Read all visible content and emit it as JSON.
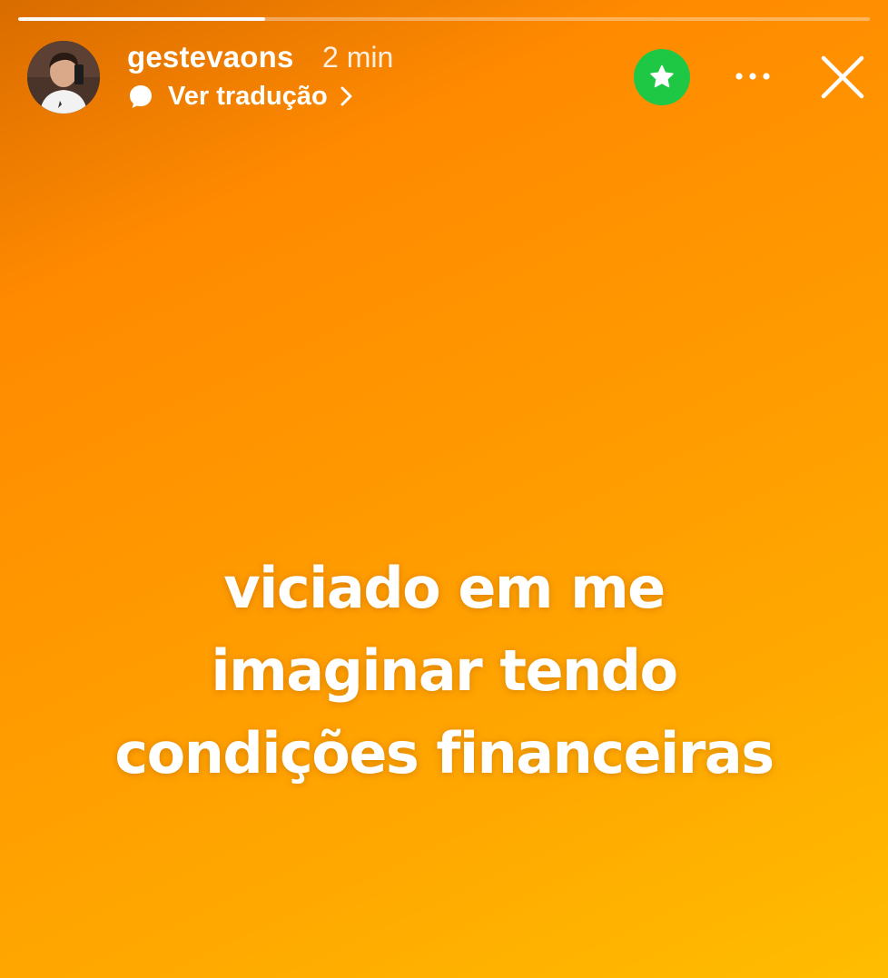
{
  "story": {
    "progress": 0.29,
    "username": "gestevaons",
    "timestamp": "2 min",
    "translate_label": "Ver tradução",
    "text_lines": [
      "viciado em me",
      "imaginar tendo",
      "condições financeiras"
    ]
  },
  "icons": {
    "translate": "speech-bubble-icon",
    "translate_chevron": "chevron-right-icon",
    "close_friends": "star-icon",
    "more": "more-horizontal-icon",
    "close": "close-icon"
  },
  "colors": {
    "close_friends_badge": "#1ec844",
    "gradient_start": "#d96c00",
    "gradient_end": "#ffbd00",
    "text": "#ffffff"
  }
}
